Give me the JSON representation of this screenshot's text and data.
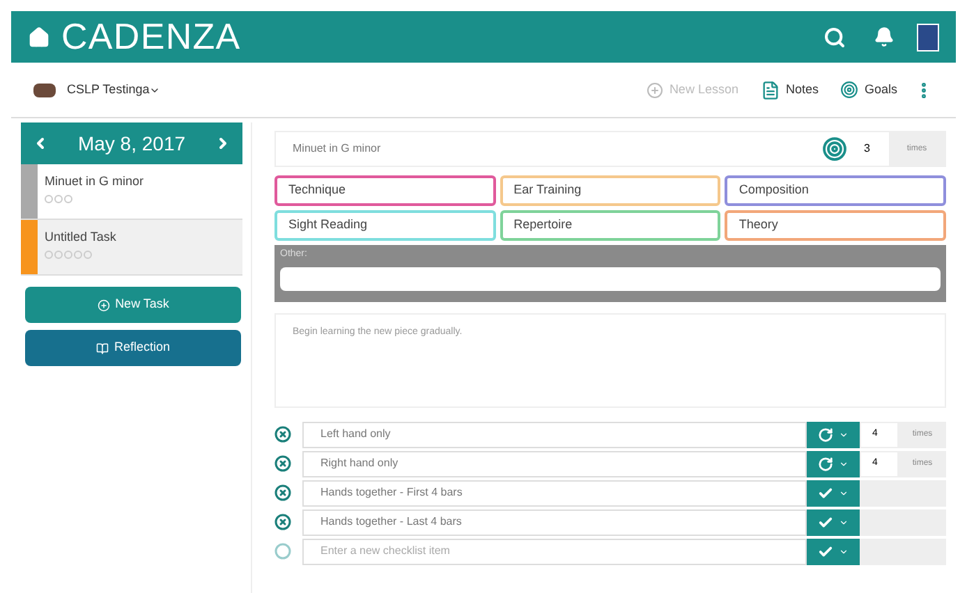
{
  "header": {
    "logo": "CADENZA"
  },
  "toolbar": {
    "student": "CSLP Testinga",
    "new_lesson": "New Lesson",
    "notes": "Notes",
    "goals": "Goals"
  },
  "sidebar": {
    "date": "May 8, 2017",
    "tasks": [
      {
        "title": "Minuet in G minor",
        "color": "#a9a9a9",
        "selected": false,
        "dots": [
          {
            "filled": false
          },
          {
            "filled": false
          },
          {
            "filled": false
          }
        ]
      },
      {
        "title": "Untitled Task",
        "color": "#f7941d",
        "selected": true,
        "dots": [
          {
            "filled": false
          },
          {
            "filled": false
          },
          {
            "filled": false
          },
          {
            "filled": false
          },
          {
            "filled": false
          }
        ]
      }
    ],
    "new_task": "New Task",
    "reflection": "Reflection"
  },
  "task": {
    "title": "Minuet in G minor",
    "count": "3",
    "unit": "times",
    "categories": [
      {
        "label": "Technique",
        "color": "#e05a9c"
      },
      {
        "label": "Ear Training",
        "color": "#f5c88c"
      },
      {
        "label": "Composition",
        "color": "#8f8fdc"
      },
      {
        "label": "Sight Reading",
        "color": "#7fdede"
      },
      {
        "label": "Repertoire",
        "color": "#7fd39a"
      },
      {
        "label": "Theory",
        "color": "#f2a77a"
      }
    ],
    "other_label": "Other:",
    "notes": "Begin learning the new piece gradually.",
    "checklist": [
      {
        "kind": "repeat",
        "text": "Left hand only",
        "count": "4",
        "unit": "times"
      },
      {
        "kind": "repeat",
        "text": "Right hand only",
        "count": "4",
        "unit": "times"
      },
      {
        "kind": "check",
        "text": "Hands together - First 4 bars"
      },
      {
        "kind": "check",
        "text": "Hands together - Last 4 bars"
      },
      {
        "kind": "new",
        "placeholder": "Enter a new checklist item"
      }
    ]
  }
}
